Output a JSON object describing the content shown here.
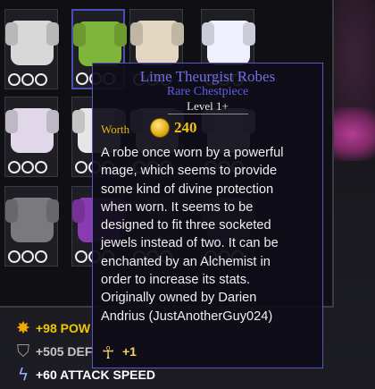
{
  "tooltip": {
    "item_name": "Lime Theurgist Robes",
    "rarity_type": "Rare Chestpiece",
    "level": "Level 1+",
    "worth_label": "Worth",
    "worth_value": "240",
    "description_lines": [
      "A robe once worn by a powerful",
      "mage, which seems to provide",
      "some kind of divine protection",
      "when worn. It seems to be",
      "designed to fit three socketed",
      "jewels instead of two. It can be",
      "enchanted by an Alchemist in",
      "order to increase its stats.",
      "Originally owned by Darien",
      "Andrius (JustAnotherGuy024)"
    ],
    "bonus_icon": "ankh-icon",
    "bonus_value": "+1",
    "colors": {
      "title": "#6f6fe8",
      "worth": "#f0c218",
      "border": "#5a56c8"
    }
  },
  "stats": [
    {
      "icon": "power-star-icon",
      "text": "+98 POW",
      "color": "#f0c800"
    },
    {
      "icon": "defense-shield-icon",
      "text": "+505 DEF",
      "color": "#c6c6c6"
    },
    {
      "icon": "attack-speed-icon",
      "text": "+60 ATTACK SPEED",
      "color": "#ffffff"
    }
  ],
  "inventory": {
    "slots": [
      {
        "icon": "white-armor-icon",
        "color": "#d8d8d8"
      },
      {
        "icon": "lime-robe-icon",
        "color": "#7fb53a"
      },
      {
        "icon": "lime-theurgist-robe-icon",
        "color": "#e2d6c0"
      },
      {
        "icon": "white-blue-robe-icon",
        "color": "#eef0ff"
      },
      {
        "icon": "white-purple-armor-icon",
        "color": "#e0d8e8"
      },
      {
        "icon": "white-armor-icon",
        "color": "#e6e6e6"
      },
      {
        "icon": "white-robe-icon",
        "color": "#eaeaea"
      },
      {
        "icon": "white-armor-icon",
        "color": "#f0f0f0"
      },
      {
        "icon": "grey-armor-icon",
        "color": "#7a7a7e"
      },
      {
        "icon": "purple-robe-icon",
        "color": "#8a3bb0"
      },
      {
        "icon": "black-white-robe-icon",
        "color": "#3a3a3a"
      },
      {
        "icon": "armor-icon",
        "color": "#555560"
      }
    ]
  }
}
